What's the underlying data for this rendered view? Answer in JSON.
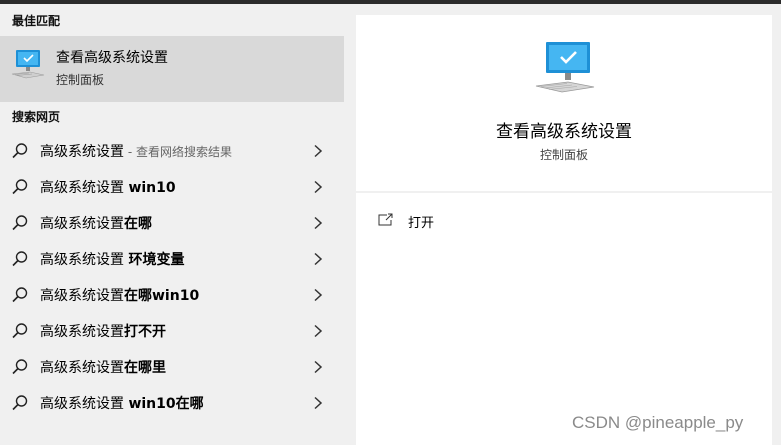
{
  "best_match": {
    "section_title": "最佳匹配",
    "title": "查看高级系统设置",
    "subtitle": "控制面板",
    "icon": "computer-monitor-icon"
  },
  "web_search": {
    "section_title": "搜索网页",
    "items": [
      {
        "prefix": "高级系统设置",
        "bold": "",
        "hint": " - 查看网络搜索结果"
      },
      {
        "prefix": "高级系统设置 ",
        "bold": "win10",
        "hint": ""
      },
      {
        "prefix": "高级系统设置",
        "bold": "在哪",
        "hint": ""
      },
      {
        "prefix": "高级系统设置 ",
        "bold": "环境变量",
        "hint": ""
      },
      {
        "prefix": "高级系统设置",
        "bold": "在哪win10",
        "hint": ""
      },
      {
        "prefix": "高级系统设置",
        "bold": "打不开",
        "hint": ""
      },
      {
        "prefix": "高级系统设置",
        "bold": "在哪里",
        "hint": ""
      },
      {
        "prefix": "高级系统设置 ",
        "bold": "win10在哪",
        "hint": ""
      }
    ]
  },
  "preview": {
    "title": "查看高级系统设置",
    "subtitle": "控制面板",
    "actions": [
      {
        "label": "打开",
        "icon": "open-window-icon"
      }
    ]
  },
  "watermark": "CSDN @pineapple_py",
  "colors": {
    "highlight": "#d9d9d9",
    "panel": "#f0f0f0",
    "preview_bg": "#ffffff",
    "monitor_accent": "#1e90d6"
  }
}
